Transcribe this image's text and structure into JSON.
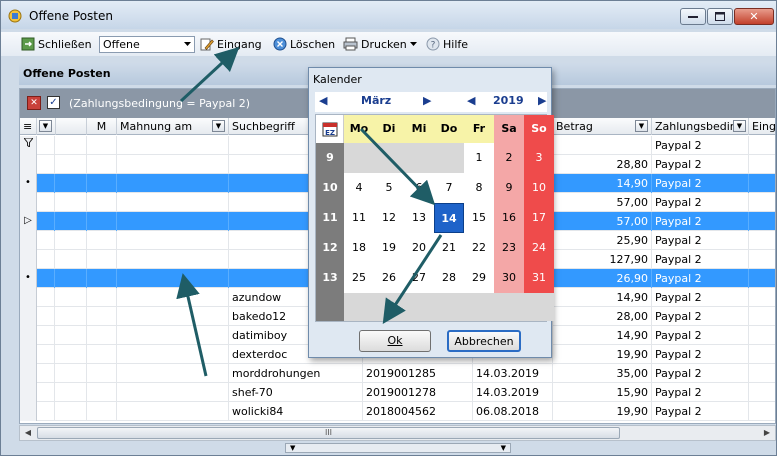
{
  "window": {
    "title": "Offene Posten"
  },
  "toolbar": {
    "close_label": "Schließen",
    "filter_value": "Offene",
    "eingang_label": "Eingang",
    "loeschen_label": "Löschen",
    "drucken_label": "Drucken",
    "hilfe_label": "Hilfe"
  },
  "section": {
    "title": "Offene Posten"
  },
  "filter": {
    "text": "(Zahlungsbedingung = Paypal 2)"
  },
  "columns": {
    "m": "M",
    "mahnung": "Mahnung am",
    "suchbegriff": "Suchbegriff",
    "betrag": "Betrag",
    "zahlungsbed": "Zahlungsbeding",
    "eingang": "Einga"
  },
  "rows": [
    {
      "indicator": "filter",
      "selected": false,
      "suchbegriff": "",
      "rechnung": "",
      "datum": "",
      "betrag": "",
      "zahlung": "Paypal 2"
    },
    {
      "indicator": "",
      "selected": false,
      "suchbegriff": "",
      "rechnung": "",
      "datum": "",
      "betrag": "28,80",
      "zahlung": "Paypal 2"
    },
    {
      "indicator": "•",
      "selected": true,
      "suchbegriff": "",
      "rechnung": "",
      "datum": "",
      "betrag": "14,90",
      "zahlung": "Paypal 2"
    },
    {
      "indicator": "",
      "selected": false,
      "suchbegriff": "",
      "rechnung": "",
      "datum": "",
      "betrag": "57,00",
      "zahlung": "Paypal 2"
    },
    {
      "indicator": "▷",
      "selected": true,
      "suchbegriff": "",
      "rechnung": "",
      "datum": "",
      "betrag": "57,00",
      "zahlung": "Paypal 2"
    },
    {
      "indicator": "",
      "selected": false,
      "suchbegriff": "",
      "rechnung": "",
      "datum": "",
      "betrag": "25,90",
      "zahlung": "Paypal 2"
    },
    {
      "indicator": "",
      "selected": false,
      "suchbegriff": "",
      "rechnung": "",
      "datum": "",
      "betrag": "127,90",
      "zahlung": "Paypal 2"
    },
    {
      "indicator": "•",
      "selected": true,
      "suchbegriff": "",
      "rechnung": "",
      "datum": "",
      "betrag": "26,90",
      "zahlung": "Paypal 2"
    },
    {
      "indicator": "",
      "selected": false,
      "suchbegriff": "azundow",
      "rechnung": "",
      "datum": "",
      "betrag": "14,90",
      "zahlung": "Paypal 2"
    },
    {
      "indicator": "",
      "selected": false,
      "suchbegriff": "bakedo12",
      "rechnung": "",
      "datum": "",
      "betrag": "28,00",
      "zahlung": "Paypal 2"
    },
    {
      "indicator": "",
      "selected": false,
      "suchbegriff": "datimiboy",
      "rechnung": "",
      "datum": "",
      "betrag": "14,90",
      "zahlung": "Paypal 2"
    },
    {
      "indicator": "",
      "selected": false,
      "suchbegriff": "dexterdoc",
      "rechnung": "",
      "datum": "",
      "betrag": "19,90",
      "zahlung": "Paypal 2"
    },
    {
      "indicator": "",
      "selected": false,
      "suchbegriff": "morddrohungen",
      "rechnung": "2019001285",
      "datum": "14.03.2019",
      "betrag": "35,00",
      "zahlung": "Paypal 2"
    },
    {
      "indicator": "",
      "selected": false,
      "suchbegriff": "shef-70",
      "rechnung": "2019001278",
      "datum": "14.03.2019",
      "betrag": "15,90",
      "zahlung": "Paypal 2"
    },
    {
      "indicator": "",
      "selected": false,
      "suchbegriff": "wolicki84",
      "rechnung": "2018004562",
      "datum": "06.08.2018",
      "betrag": "19,90",
      "zahlung": "Paypal 2"
    }
  ],
  "calendar": {
    "title": "Kalender",
    "month": "März",
    "year": "2019",
    "weekdays": [
      "Mo",
      "Di",
      "Mi",
      "Do",
      "Fr",
      "Sa",
      "So"
    ],
    "weeks": [
      {
        "kw": "9",
        "days": [
          "",
          "",
          "",
          "",
          "1",
          "2",
          "3"
        ]
      },
      {
        "kw": "10",
        "days": [
          "4",
          "5",
          "6",
          "7",
          "8",
          "9",
          "10"
        ]
      },
      {
        "kw": "11",
        "days": [
          "11",
          "12",
          "13",
          "14",
          "15",
          "16",
          "17"
        ]
      },
      {
        "kw": "12",
        "days": [
          "18",
          "19",
          "20",
          "21",
          "22",
          "23",
          "24"
        ]
      },
      {
        "kw": "13",
        "days": [
          "25",
          "26",
          "27",
          "28",
          "29",
          "30",
          "31"
        ]
      }
    ],
    "selected_day": "14",
    "ok_label": "Ok",
    "cancel_label": "Abbrechen"
  },
  "scrollbar": {
    "thumb_grip": "III"
  }
}
